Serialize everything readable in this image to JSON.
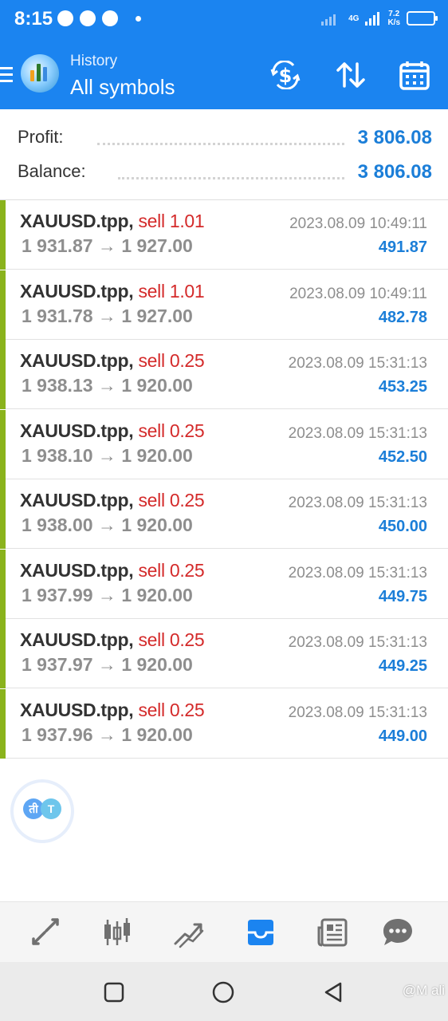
{
  "status_bar": {
    "time": "8:15",
    "network_type": "4G",
    "speed_value": "7.2",
    "speed_unit": "K/s"
  },
  "app_bar": {
    "subtitle": "History",
    "title": "All symbols",
    "actions": [
      "currency-exchange-icon",
      "sort-icon",
      "calendar-icon"
    ]
  },
  "summary": {
    "profit_label": "Profit:",
    "profit_value": "3 806.08",
    "balance_label": "Balance:",
    "balance_value": "3 806.08"
  },
  "trades": [
    {
      "symbol": "XAUUSD.tpp,",
      "direction": "sell 1.01",
      "open": "1 931.87",
      "arrow": "→",
      "close": "1 927.00",
      "time": "2023.08.09 10:49:11",
      "profit": "491.87"
    },
    {
      "symbol": "XAUUSD.tpp,",
      "direction": "sell 1.01",
      "open": "1 931.78",
      "arrow": "→",
      "close": "1 927.00",
      "time": "2023.08.09 10:49:11",
      "profit": "482.78"
    },
    {
      "symbol": "XAUUSD.tpp,",
      "direction": "sell 0.25",
      "open": "1 938.13",
      "arrow": "→",
      "close": "1 920.00",
      "time": "2023.08.09 15:31:13",
      "profit": "453.25"
    },
    {
      "symbol": "XAUUSD.tpp,",
      "direction": "sell 0.25",
      "open": "1 938.10",
      "arrow": "→",
      "close": "1 920.00",
      "time": "2023.08.09 15:31:13",
      "profit": "452.50"
    },
    {
      "symbol": "XAUUSD.tpp,",
      "direction": "sell 0.25",
      "open": "1 938.00",
      "arrow": "→",
      "close": "1 920.00",
      "time": "2023.08.09 15:31:13",
      "profit": "450.00"
    },
    {
      "symbol": "XAUUSD.tpp,",
      "direction": "sell 0.25",
      "open": "1 937.99",
      "arrow": "→",
      "close": "1 920.00",
      "time": "2023.08.09 15:31:13",
      "profit": "449.75"
    },
    {
      "symbol": "XAUUSD.tpp,",
      "direction": "sell 0.25",
      "open": "1 937.97",
      "arrow": "→",
      "close": "1 920.00",
      "time": "2023.08.09 15:31:13",
      "profit": "449.25"
    },
    {
      "symbol": "XAUUSD.tpp,",
      "direction": "sell 0.25",
      "open": "1 937.96",
      "arrow": "→",
      "close": "1 920.00",
      "time": "2023.08.09 15:31:13",
      "profit": "449.00"
    }
  ],
  "translate_button": {
    "left_glyph": "ती",
    "right_glyph": "T"
  },
  "bottom_nav": [
    "quotes-icon",
    "chart-icon",
    "trade-icon",
    "history-icon",
    "news-icon",
    "chat-icon"
  ],
  "active_tab": "history-icon",
  "watermark": "@M ali",
  "colors": {
    "primary": "#1b84f0",
    "profit": "#1b7ed8",
    "sell": "#d42a2a",
    "trade_bar": "#8ab31c"
  }
}
